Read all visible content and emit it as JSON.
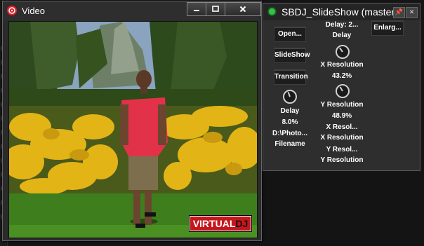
{
  "video_window": {
    "title": "Video",
    "logo": {
      "virtual": "VIRTUAL",
      "dj": "DJ"
    }
  },
  "slideshow": {
    "title": "SBDJ_SlideShow (master)",
    "buttons": {
      "open": "Open...",
      "slideshow": "SlideShow",
      "transition": "Transition",
      "enlarge": "Enlarg..."
    },
    "labels": {
      "delay_value_top": "Delay: 2...",
      "delay_top": "Delay",
      "x_res_title": "X Resolution",
      "x_res_value": "43.2%",
      "y_res_title": "Y Resolution",
      "y_res_value": "48.9%",
      "delay_left": "Delay",
      "delay_left_value": "8.0%",
      "path_value": "D:\\Photo...",
      "filename": "Filename",
      "x_res_short_1": "X Resol...",
      "x_res_full_1": "X Resolution",
      "y_res_short_1": "Y Resol...",
      "y_res_full_1": "Y Resolution"
    }
  },
  "colors": {
    "led": "#28c840",
    "logo_red": "#c4161c"
  }
}
